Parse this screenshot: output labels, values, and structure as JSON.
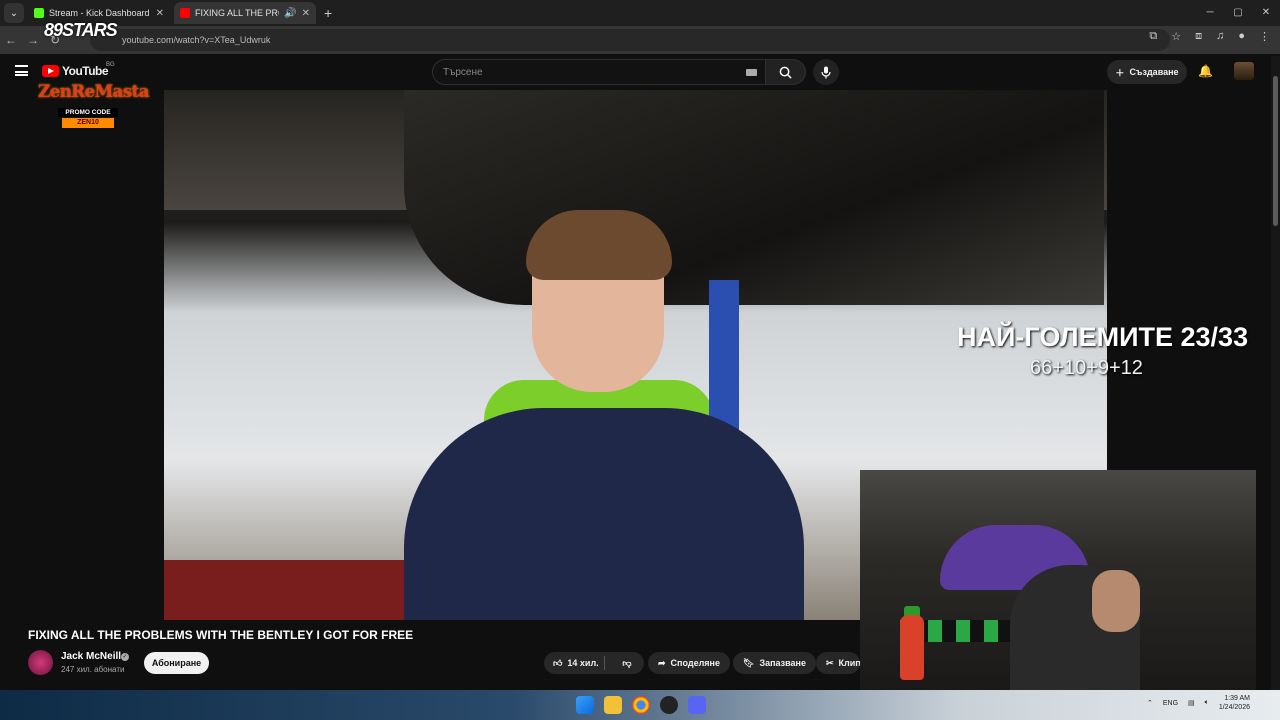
{
  "browser": {
    "tabs": [
      {
        "title": "Stream - Kick Dashboard",
        "active": false,
        "favicon_color": "#53fc18"
      },
      {
        "title": "FIXING ALL THE PROBLEMS",
        "active": true,
        "favicon_color": "#ff0000"
      }
    ],
    "url": "youtube.com/watch?v=XTea_Udwruk"
  },
  "youtube": {
    "logo": "YouTube",
    "country": "BG",
    "search_placeholder": "Търсене",
    "create_label": "Създаване"
  },
  "overlay": {
    "promo_stars": "89STARS",
    "promo_brand": "ZenReMasta",
    "promo_code_label": "PROMO CODE",
    "promo_code": "ZEN10",
    "headline": "НАЙ-ГОЛЕМИТЕ 23/33",
    "subline": "66+10+9+12"
  },
  "video": {
    "title": "FIXING ALL THE PROBLEMS WITH THE BENTLEY I GOT FOR FREE",
    "channel": "Jack McNeill",
    "subscribers": "247 хил. абонати",
    "subscribe_label": "Абониране",
    "likes": "14 хил.",
    "share_label": "Споделяне",
    "save_label": "Запазване",
    "clip_label": "Клип"
  },
  "taskbar": {
    "lang": "ENG",
    "time": "1:39 AM",
    "date": "1/24/2026"
  }
}
